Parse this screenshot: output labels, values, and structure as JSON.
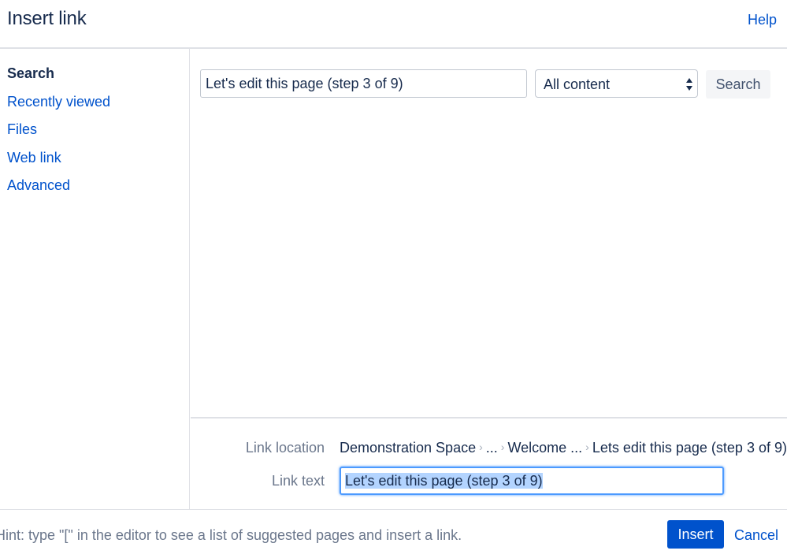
{
  "dialog": {
    "title": "Insert link",
    "help_label": "Help"
  },
  "sidebar": {
    "items": [
      {
        "label": "Search",
        "active": true
      },
      {
        "label": "Recently viewed"
      },
      {
        "label": "Files"
      },
      {
        "label": "Web link"
      },
      {
        "label": "Advanced"
      }
    ]
  },
  "search": {
    "query": "Let's edit this page (step 3 of 9)",
    "scope_selected": "All content",
    "button_label": "Search"
  },
  "link": {
    "location_label": "Link location",
    "location_breadcrumb": [
      "Demonstration Space",
      "...",
      "Welcome ...",
      "Lets edit this page (step 3 of 9)"
    ],
    "text_label": "Link text",
    "text_value": "Let's edit this page (step 3 of 9)"
  },
  "footer": {
    "hint": "Hint: type \"[\" in the editor to see a list of suggested pages and insert a link.",
    "insert_label": "Insert",
    "cancel_label": "Cancel"
  },
  "colors": {
    "link_blue": "#0052cc",
    "primary_button": "#0052cc",
    "focus_ring": "#4c9aff",
    "text_selection": "#b3d4ff"
  }
}
